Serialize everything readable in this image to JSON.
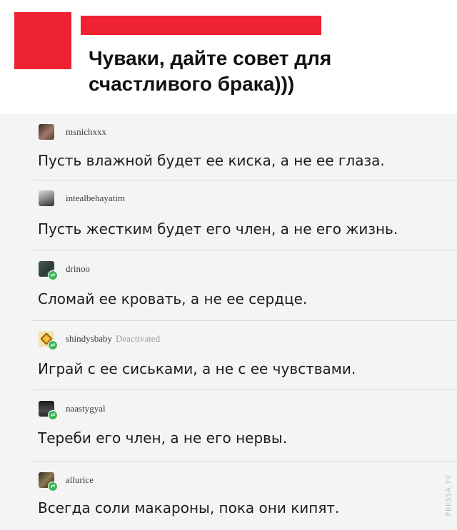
{
  "post": {
    "title_line1": "Чуваки, дайте совет для",
    "title_line2": "счастливого брака)))"
  },
  "comments": [
    {
      "username": "msnichxxx",
      "text": "Пусть влажной будет ее киска, а не ее глаза.",
      "reblog": false
    },
    {
      "username": "intealbehayatim",
      "text": "Пусть жестким будет его член, а не его жизнь.",
      "reblog": false
    },
    {
      "username": "drinoo",
      "text": "Сломай ее кровать, а не ее сердце.",
      "reblog": true
    },
    {
      "username": "shindysbaby",
      "status": "Deactivated",
      "text": "Играй с ее сиськами, а не с ее чувствами.",
      "reblog": true
    },
    {
      "username": "naastygyal",
      "text": "Тереби его член, а не его нервы.",
      "reblog": true
    },
    {
      "username": "allurice",
      "text": "Всегда соли макароны, пока они кипят.",
      "reblog": true
    }
  ],
  "icons": {
    "reblog": "reblog-icon"
  },
  "colors": {
    "accent_red": "#ee2230",
    "reblog_green": "#3fb45a",
    "comments_bg": "#f4f4f4"
  },
  "watermark": "PRESSA.TV"
}
